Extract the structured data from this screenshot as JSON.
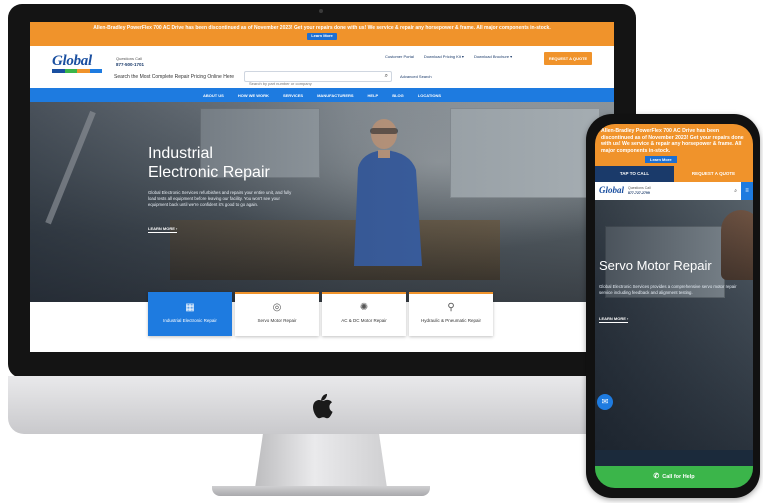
{
  "desktop": {
    "announcement": {
      "text": "Allen-Bradley PowerFlex 700 AC Drive has been discontinued as of November 2023! Get your repairs done with us! We service & repair any horsepower & frame. All major components in-stock.",
      "button": "Learn More"
    },
    "header": {
      "logo": "Global",
      "phone_label": "Questions Call",
      "phone": "877-500-1701",
      "search_label": "Search the Most Complete Repair Pricing Online Here",
      "search_placeholder": "Search by part number or company",
      "advanced_search": "Advanced Search",
      "links": [
        "Customer Portal",
        "Download Pricing Kit ▾",
        "Download Brochure ▾"
      ],
      "quote_button": "REQUEST A QUOTE"
    },
    "nav": [
      "ABOUT US",
      "HOW WE WORK",
      "SERVICES",
      "MANUFACTURERS",
      "HELP",
      "BLOG",
      "LOCATIONS"
    ],
    "hero": {
      "title_line1": "Industrial",
      "title_line2": "Electronic Repair",
      "text": "Global Electronic Services refurbishes and repairs your entire unit, and fully load tests all equipment before leaving our facility. You won't see your equipment back until we're confident it's good to go again.",
      "learn_more": "LEARN MORE ›"
    },
    "cards": [
      {
        "label": "Industrial Electronic Repair",
        "icon": "circuit-board-icon",
        "active": true
      },
      {
        "label": "Servo Motor Repair",
        "icon": "servo-motor-icon",
        "active": false
      },
      {
        "label": "AC & DC Motor Repair",
        "icon": "motor-icon",
        "active": false
      },
      {
        "label": "Hydraulic & Pneumatic Repair",
        "icon": "hydraulic-icon",
        "active": false
      }
    ]
  },
  "mobile": {
    "announcement": {
      "text": "Allen-Bradley PowerFlex 700 AC Drive has been discontinued as of November 2023! Get your repairs done with us! We service & repair any horsepower & frame. All major components in-stock.",
      "button": "Learn More"
    },
    "tabs": {
      "call": "TAP TO CALL",
      "quote": "REQUEST A QUOTE"
    },
    "header": {
      "logo": "Global",
      "phone_label": "Questions Call",
      "phone": "877-727-2799"
    },
    "hero": {
      "title": "Servo Motor Repair",
      "text": "Global Electronic Services provides a comprehensive servo motor repair service including feedback and alignment testing.",
      "learn_more": "LEARN MORE ›"
    },
    "call_button": "Call for Help"
  },
  "colors": {
    "orange": "#f0932b",
    "blue": "#1e7be0",
    "navy": "#1a3a6a",
    "green": "#3bb54a"
  }
}
